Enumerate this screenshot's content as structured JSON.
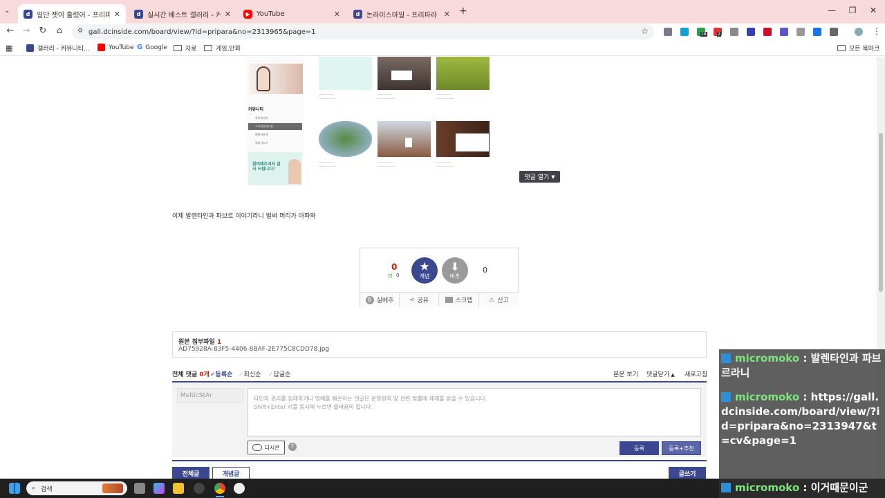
{
  "browser": {
    "tabs": [
      {
        "title": "일단 잿이 흘렀어 - 프리파라 갤",
        "favicon": "dc",
        "active": true
      },
      {
        "title": "실시간 베스트 갤러리 - 커뮤니티",
        "favicon": "dc",
        "active": false
      },
      {
        "title": "YouTube",
        "favicon": "yt",
        "active": false
      },
      {
        "title": "논라미스마일 - 프리파라 갤러리",
        "favicon": "dc",
        "active": false
      }
    ],
    "url": "gall.dcinside.com/board/view/?id=pripara&no=2313965&page=1",
    "bookmarks": [
      "갤러리 - 커뮤니티...",
      "YouTube",
      "Google",
      "자료",
      "게임,만화"
    ],
    "all_bookmarks": "모든 북마크",
    "ext_badges": [
      "18",
      "2"
    ]
  },
  "embedded": {
    "sidebar_heading": "커뮤니티",
    "sidebar_items": [
      "자유게시판",
      "스크린샷게시판",
      "팬픽자유게",
      "앨리사뉴기"
    ],
    "banner_text": "참여해주셔서 감사 드립니다!",
    "collapse_label": "댓글 열기"
  },
  "post": {
    "body_text": "이제 발렌타인과 파브르 이야기라니 벌써 머리가 아파와"
  },
  "vote": {
    "up_count": "0",
    "fixed_count": "0",
    "up_label": "개념",
    "down_label": "비추",
    "down_count": "0",
    "actions": [
      "실베추",
      "공유",
      "스크랩",
      "신고"
    ]
  },
  "attachments": {
    "heading": "원본 첨부파일",
    "count": "1",
    "filename": "AD75928A-83F5-4406-8BAF-2E775C8CDD78.jpg"
  },
  "comments": {
    "total_label": "전체 댓글",
    "total_count": "0개",
    "sort_options": [
      "등록순",
      "최신순",
      "답글순"
    ],
    "right_links": [
      "본문 보기",
      "댓글닫기",
      "새로고침"
    ],
    "nickname": "MelticStAr",
    "placeholder_line1": "타인의 권리를 침해하거나 명예를 훼손하는 댓글은 운영원칙 및 관련 법률에 제재를 받을 수 있습니다.",
    "placeholder_line2": "Shift+Enter 키를 동시에 누르면 줄바꿈이 됩니다.",
    "dccon_label": "디시콘",
    "submit_label": "등록",
    "submit_recommend_label": "등록+추천"
  },
  "bottom_buttons": {
    "all": "전체글",
    "concept": "개념글",
    "write": "글쓰기"
  },
  "chat": [
    {
      "nick": "micromoko",
      "sep": " : ",
      "msg": "발렌타인과 파브르라니"
    },
    {
      "nick": "micromoko",
      "sep": " : ",
      "msg": "https://gall.dcinside.com/board/view/?id=pripara&no=2313947&t=cv&page=1"
    },
    {
      "nick": "micromoko",
      "sep": " : ",
      "msg": "이거때문이군"
    }
  ],
  "taskbar": {
    "search_placeholder": "검색"
  },
  "colors": {
    "tabstrip": "#f9dada",
    "dc_blue": "#3b4890",
    "comment_count_red": "#d31900",
    "chat_nick": "#7ee47e"
  }
}
